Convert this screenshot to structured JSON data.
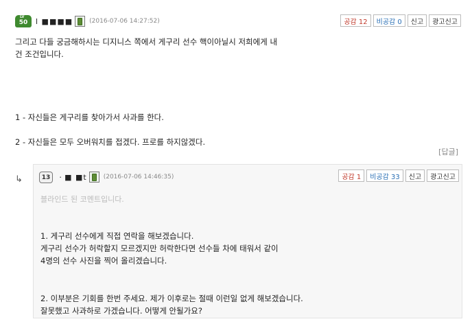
{
  "comment": {
    "level": "50",
    "level_prefix": "LV",
    "nick": "l ■■■■",
    "timestamp": "(2016-07-06 14:27:52)",
    "buttons": {
      "up": "공감 12",
      "down": "비공감 0",
      "report": "신고",
      "ad_report": "광고신고"
    },
    "lines": [
      "그리고 다들 궁금해하시는 디지니스 쪽에서 게구리 선수 핵이아닐시 저희에게 내",
      "건 조건입니다.",
      "1 - 자신들은 게구리를 찾아가서 사과를 한다.",
      "2 - 자신들은 모두 오버워치를 접겠다. 프로를 하지않겠다."
    ]
  },
  "reply_label": "[답글]",
  "reply_arrow": "↳",
  "reply": {
    "level": "13",
    "nick": "ㆍ■ ■t",
    "timestamp": "(2016-07-06 14:46:35)",
    "buttons": {
      "up": "공감 1",
      "down": "비공감 33",
      "report": "신고",
      "ad_report": "광고신고"
    },
    "blinded": "블라인드 된 코멘트입니다.",
    "lines": [
      "1. 게구리 선수에게 직접 연락을 해보겠습니다.",
      "    게구리 선수가 허락할지 모르겠지만 허락한다면 선수들 차에 태워서 같이",
      "     4명의 선수 사진을 찍어 올리겠습니다.",
      "2. 이부분은 기회를 한번 주세요. 제가 이후로는 절때 이런일 없게 해보겠습니다.",
      "     잘못했고 사과하로 가겠습니다. 어떻게 안될가요?"
    ]
  }
}
